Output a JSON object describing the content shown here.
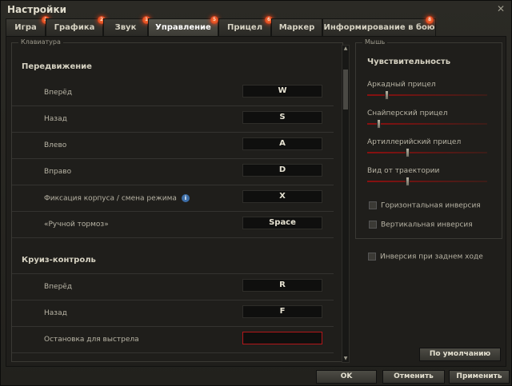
{
  "window": {
    "title": "Настройки"
  },
  "tabs": [
    {
      "label": "Игра",
      "badge": "1"
    },
    {
      "label": "Графика",
      "badge": "2"
    },
    {
      "label": "Звук",
      "badge": "1"
    },
    {
      "label": "Управление",
      "badge": "5",
      "active": true
    },
    {
      "label": "Прицел",
      "badge": "6"
    },
    {
      "label": "Маркер",
      "badge": ""
    },
    {
      "label": "Информирование в бою",
      "badge": "8"
    }
  ],
  "keyboard": {
    "legend": "Клавиатура",
    "movement": {
      "title": "Передвижение",
      "rows": [
        {
          "label": "Вперёд",
          "key": "W"
        },
        {
          "label": "Назад",
          "key": "S"
        },
        {
          "label": "Влево",
          "key": "A"
        },
        {
          "label": "Вправо",
          "key": "D"
        },
        {
          "label": "Фиксация корпуса / смена режима",
          "key": "X",
          "info": "i"
        },
        {
          "label": "«Ручной тормоз»",
          "key": "Space"
        }
      ]
    },
    "cruise": {
      "title": "Круиз-контроль",
      "rows": [
        {
          "label": "Вперёд",
          "key": "R"
        },
        {
          "label": "Назад",
          "key": "F"
        },
        {
          "label": "Остановка для выстрела",
          "key": ""
        }
      ]
    }
  },
  "mouse": {
    "legend": "Мышь",
    "title": "Чувствительность",
    "sliders": [
      {
        "label": "Аркадный прицел",
        "value": 0.15
      },
      {
        "label": "Снайперский прицел",
        "value": 0.08
      },
      {
        "label": "Артиллерийский прицел",
        "value": 0.33
      },
      {
        "label": "Вид от траектории",
        "value": 0.33
      }
    ],
    "checkboxes": [
      {
        "label": "Горизонтальная инверсия",
        "checked": false
      },
      {
        "label": "Вертикальная инверсия",
        "checked": false
      }
    ],
    "reverse_inversion": {
      "label": "Инверсия при заднем ходе",
      "checked": false
    }
  },
  "buttons": {
    "default": "По умолчанию",
    "ok": "OK",
    "cancel": "Отменить",
    "apply": "Применить"
  },
  "icons": {
    "close": "close-icon",
    "info": "info-icon"
  }
}
